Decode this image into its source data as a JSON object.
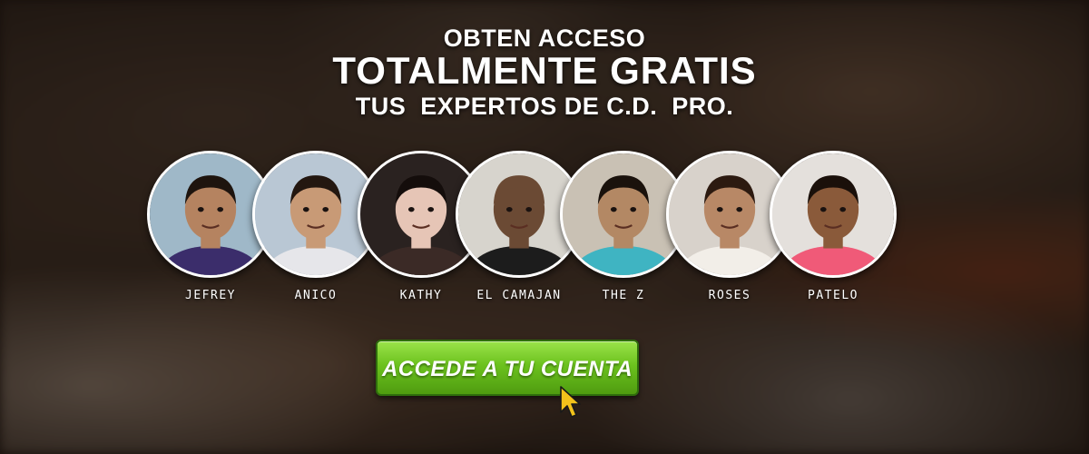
{
  "headline": {
    "line1": "OBTEN ACCESO",
    "line2": "TOTALMENTE GRATIS",
    "line3": "TUS  EXPERTOS DE C.D.  PRO."
  },
  "experts": [
    {
      "name": "JEFREY",
      "bg": "#9fb8c8",
      "skin": "#b58360",
      "hair": "#1e140e",
      "shirt": "#3b2d6b"
    },
    {
      "name": "ANICO",
      "bg": "#b9c7d4",
      "skin": "#c89a76",
      "hair": "#231710",
      "shirt": "#e6e6ea"
    },
    {
      "name": "KATHY",
      "bg": "#2a2220",
      "skin": "#e6c5b6",
      "hair": "#140d0b",
      "shirt": "#3b2a26"
    },
    {
      "name": "EL CAMAJAN",
      "bg": "#d7d4cd",
      "skin": "#6b4a34",
      "hair": "#6b4a34",
      "shirt": "#1c1c1c"
    },
    {
      "name": "THE Z",
      "bg": "#c9c1b4",
      "skin": "#b38864",
      "hair": "#1a120c",
      "shirt": "#3fb4c2"
    },
    {
      "name": "ROSES",
      "bg": "#d8d2cb",
      "skin": "#b88866",
      "hair": "#2c1a10",
      "shirt": "#f2eee8"
    },
    {
      "name": "PATELO",
      "bg": "#e4e0dc",
      "skin": "#8a5a3a",
      "hair": "#1a100a",
      "shirt": "#f05a78"
    }
  ],
  "cta": {
    "label": "ACCEDE A TU CUENTA"
  },
  "colors": {
    "cta_green": "#6cc21e",
    "cursor": "#f2c21b"
  }
}
